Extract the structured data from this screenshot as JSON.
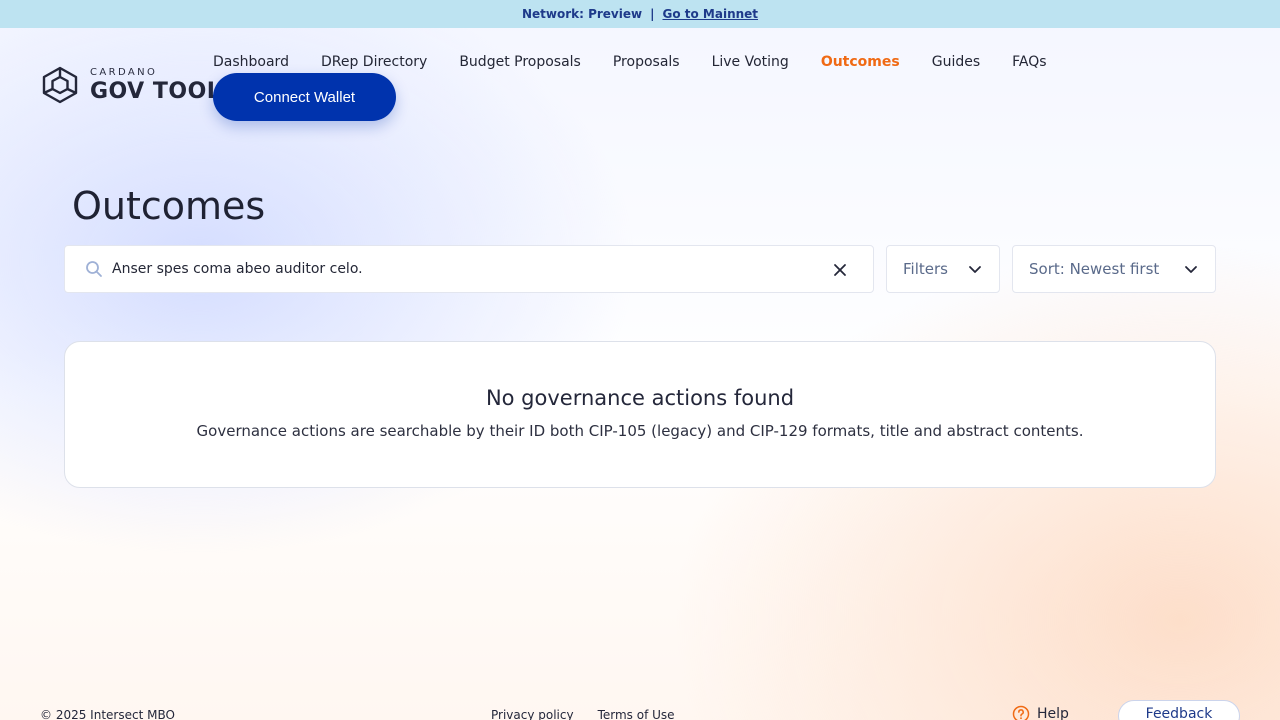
{
  "banner": {
    "network_text": "Network: Preview",
    "separator": "|",
    "link_text": "Go to Mainnet"
  },
  "brand": {
    "small": "CARDANO",
    "big": "GOV TOOL"
  },
  "nav": {
    "items": [
      {
        "label": "Dashboard"
      },
      {
        "label": "DRep Directory"
      },
      {
        "label": "Budget Proposals"
      },
      {
        "label": "Proposals"
      },
      {
        "label": "Live Voting"
      },
      {
        "label": "Outcomes",
        "active": true
      },
      {
        "label": "Guides"
      },
      {
        "label": "FAQs"
      }
    ],
    "connect_label": "Connect Wallet"
  },
  "main": {
    "title": "Outcomes",
    "search": {
      "value": "Anser spes coma abeo auditor celo.",
      "placeholder": ""
    },
    "filters_label": "Filters",
    "sort_label": "Sort: Newest first",
    "empty": {
      "title": "No governance actions found",
      "description": "Governance actions are searchable by their ID both CIP-105 (legacy) and CIP-129 formats, title and abstract contents."
    }
  },
  "footer": {
    "copyright": "© 2025 Intersect MBO",
    "privacy": "Privacy policy",
    "terms": "Terms of Use",
    "help": "Help",
    "feedback": "Feedback"
  },
  "colors": {
    "accent": "#0033ad",
    "active_nav": "#f06a14",
    "banner_bg": "#bde3f1"
  }
}
